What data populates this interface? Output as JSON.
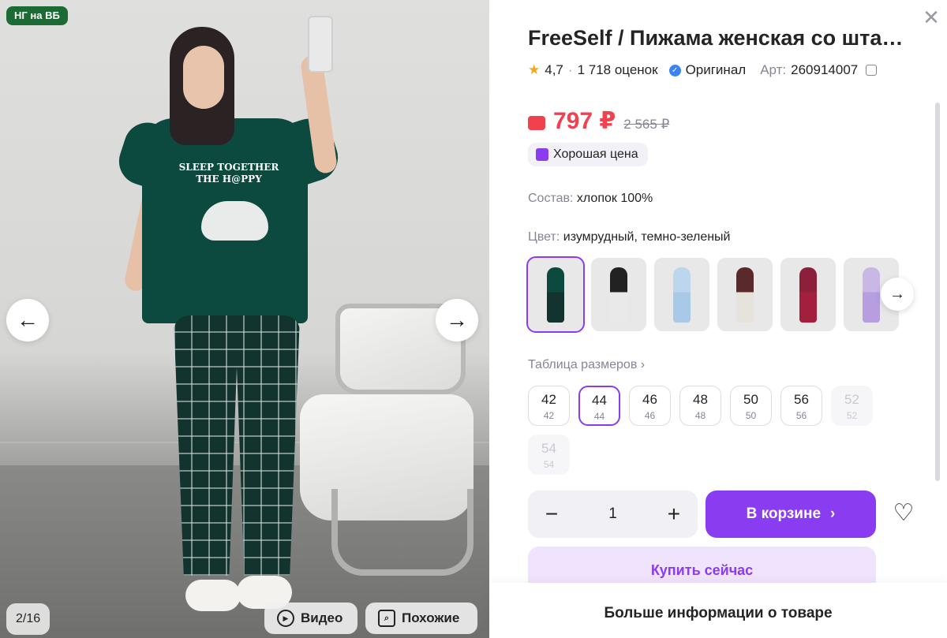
{
  "gallery": {
    "badge": "НГ на ВБ",
    "counter": "2/16",
    "print_line1": "SLEEP TOGETHER",
    "print_line2": "THE H@PPY",
    "video_label": "Видео",
    "similar_label": "Похожие"
  },
  "product": {
    "title": "FreeSelf / Пижама женская со штанами",
    "rating": "4,7",
    "reviews": "1 718 оценок",
    "original": "Оригинал",
    "art_label": "Арт:",
    "art_value": "260914007",
    "price": "797 ₽",
    "old_price": "2 565 ₽",
    "good_price": "Хорошая цена",
    "composition_label": "Состав:",
    "composition_value": "хлопок 100%",
    "color_label": "Цвет:",
    "color_value": "изумрудный, темно-зеленый",
    "size_table": "Таблица размеров ›"
  },
  "swatches": [
    {
      "top": "#0c4a3f",
      "bottom": "#13332f"
    },
    {
      "top": "#222222",
      "bottom": "#e9e9e9"
    },
    {
      "top": "#bcd6ee",
      "bottom": "#a9c9e8"
    },
    {
      "top": "#5a2a2a",
      "bottom": "#e6e2dc"
    },
    {
      "top": "#8c1f3a",
      "bottom": "#a3203c"
    },
    {
      "top": "#c9b7e6",
      "bottom": "#b79fdf"
    }
  ],
  "sizes": [
    {
      "ru": "42",
      "eu": "42",
      "state": "normal"
    },
    {
      "ru": "44",
      "eu": "44",
      "state": "active"
    },
    {
      "ru": "46",
      "eu": "46",
      "state": "normal"
    },
    {
      "ru": "48",
      "eu": "48",
      "state": "normal"
    },
    {
      "ru": "50",
      "eu": "50",
      "state": "normal"
    },
    {
      "ru": "56",
      "eu": "56",
      "state": "normal"
    },
    {
      "ru": "52",
      "eu": "52",
      "state": "disabled"
    },
    {
      "ru": "54",
      "eu": "54",
      "state": "disabled"
    }
  ],
  "cart": {
    "quantity": "1",
    "minus": "−",
    "plus": "+",
    "in_cart": "В корзине",
    "buy_now": "Купить сейчас"
  },
  "more_info": "Больше информации о товаре",
  "colors": {
    "accent": "#8a3cf0",
    "price": "#f1414f",
    "badge_green": "#1c6b34"
  },
  "icons": [
    "close-icon",
    "star-icon",
    "verified-icon",
    "copy-icon",
    "wallet-icon",
    "thumbs-up-icon",
    "arrow-left-icon",
    "arrow-right-icon",
    "play-icon",
    "search-similar-icon",
    "heart-icon",
    "chevron-right-icon"
  ]
}
